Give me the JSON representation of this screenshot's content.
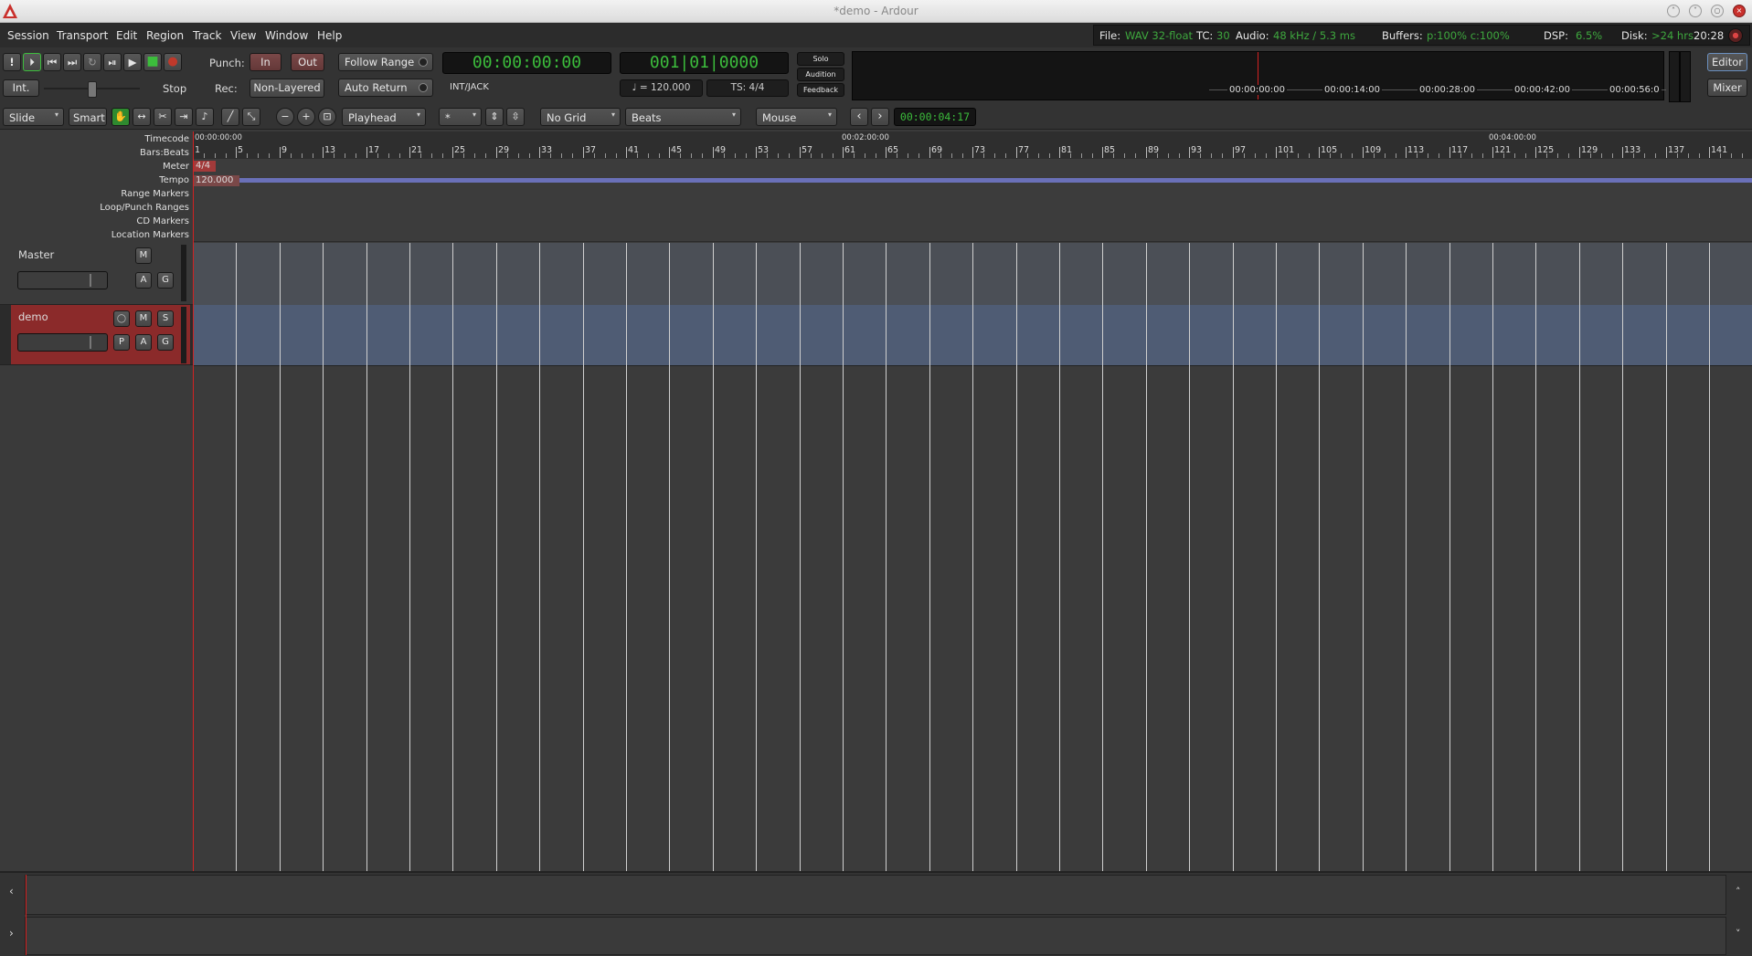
{
  "window": {
    "title": "*demo - Ardour"
  },
  "menu": [
    "Session",
    "Transport",
    "Edit",
    "Region",
    "Track",
    "View",
    "Window",
    "Help"
  ],
  "status": {
    "file_label": "File:",
    "file_value": "WAV 32-float",
    "tc_label": "TC:",
    "tc_value": "30",
    "audio_label": "Audio:",
    "audio_value": "48 kHz / 5.3 ms",
    "buffers_label": "Buffers:",
    "buffers_value": "p:100% c:100%",
    "dsp_label": "DSP:",
    "dsp_value": "6.5%",
    "disk_label": "Disk:",
    "disk_value": ">24 hrs",
    "clock": "20:28"
  },
  "transport": {
    "int_label": "Int.",
    "stop_label": "Stop",
    "punch_label": "Punch:",
    "punch_in": "In",
    "punch_out": "Out",
    "rec_label": "Rec:",
    "rec_mode": "Non-Layered",
    "follow_range": "Follow Range",
    "auto_return": "Auto Return",
    "primary_clock": "00:00:00:00",
    "clock_source": "INT/JACK",
    "secondary_clock": "001|01|0000",
    "tempo": "♩ = 120.000",
    "ts": "TS: 4/4",
    "solo": "Solo",
    "audition": "Audition",
    "feedback": "Feedback"
  },
  "mini_timeline": {
    "times": [
      "00:00:00:00",
      "00:00:14:00",
      "00:00:28:00",
      "00:00:42:00",
      "00:00:56:0"
    ]
  },
  "view_buttons": {
    "editor": "Editor",
    "mixer": "Mixer"
  },
  "edit_toolbar": {
    "edit_mode": "Slide",
    "smart": "Smart",
    "zoom_focus": "Playhead",
    "grid_x": "*",
    "grid_mode": "No Grid",
    "grid_type": "Beats",
    "edit_point": "Mouse",
    "nudge_clock": "00:00:04:17"
  },
  "ruler_labels": [
    "Timecode",
    "Bars:Beats",
    "Meter",
    "Tempo",
    "Range Markers",
    "Loop/Punch Ranges",
    "CD Markers",
    "Location Markers"
  ],
  "timecode_marks": [
    "00:00:00:00",
    "00:02:00:00",
    "00:04:00:00"
  ],
  "bar_numbers": [
    "1",
    "5",
    "9",
    "13",
    "17",
    "21",
    "25",
    "29",
    "33",
    "37",
    "41",
    "45",
    "49",
    "53",
    "57",
    "61",
    "65",
    "69",
    "73",
    "77",
    "81",
    "85",
    "89",
    "93",
    "97",
    "101",
    "105",
    "109",
    "113",
    "117",
    "121",
    "125",
    "129",
    "133",
    "137",
    "141",
    "1"
  ],
  "meter_marker": "4/4",
  "tempo_marker": "120.000",
  "tracks": [
    {
      "name": "Master",
      "buttons_top": [
        "M"
      ],
      "buttons_bottom": [
        "A",
        "G"
      ]
    },
    {
      "name": "demo",
      "buttons_top": [
        "M",
        "S"
      ],
      "buttons_bottom": [
        "P",
        "A",
        "G"
      ]
    }
  ],
  "summary": {
    "left_top": "‹",
    "left_bottom": "›",
    "right_top": "˄",
    "right_bottom": "˅"
  },
  "colors": {
    "lcd_green": "#3cbd3c",
    "playhead": "#d22222",
    "track_selected": "#8b2a2a"
  }
}
